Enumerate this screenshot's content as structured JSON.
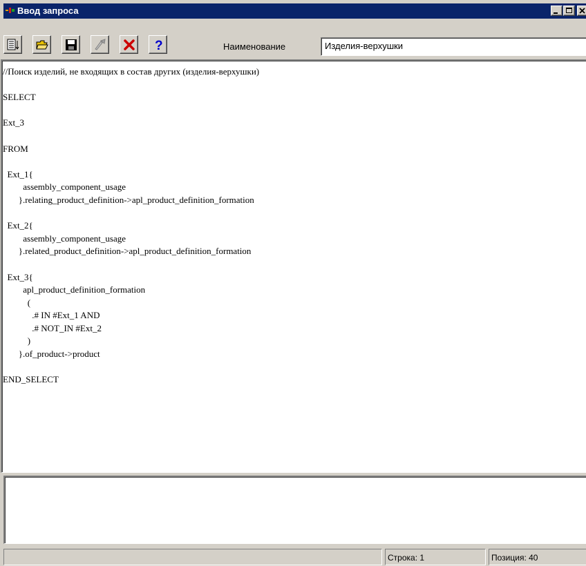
{
  "window": {
    "title": "Ввод запроса",
    "controls": [
      "minimize",
      "maximize",
      "close"
    ]
  },
  "toolbar": {
    "buttons": [
      {
        "name": "sort-list-icon"
      },
      {
        "name": "open-folder-icon"
      },
      {
        "name": "save-disk-icon"
      },
      {
        "name": "run-query-icon"
      },
      {
        "name": "delete-x-icon"
      },
      {
        "name": "help-question-icon"
      }
    ],
    "name_label": "Наименование",
    "name_value": "Изделия-верхушки"
  },
  "editor": {
    "lines": [
      "//Поиск изделий, не входящих в состав других (изделия-верхушки)",
      "",
      "SELECT",
      "",
      "Ext_3",
      "",
      "FROM",
      "",
      "  Ext_1{",
      "         assembly_component_usage",
      "       }.relating_product_definition->apl_product_definition_formation",
      "",
      "  Ext_2{",
      "         assembly_component_usage",
      "       }.related_product_definition->apl_product_definition_formation",
      "",
      "  Ext_3{",
      "         apl_product_definition_formation",
      "           (",
      "             .# IN #Ext_1 AND",
      "             .# NOT_IN #Ext_2",
      "           )",
      "       }.of_product->product",
      "",
      "END_SELECT"
    ]
  },
  "status": {
    "main": "",
    "line": "Строка: 1",
    "position": "Позиция: 40"
  },
  "colors": {
    "titlebar": "#0a246a",
    "face": "#d4d0c8",
    "delete": "#cc0000",
    "help": "#0000cc"
  }
}
